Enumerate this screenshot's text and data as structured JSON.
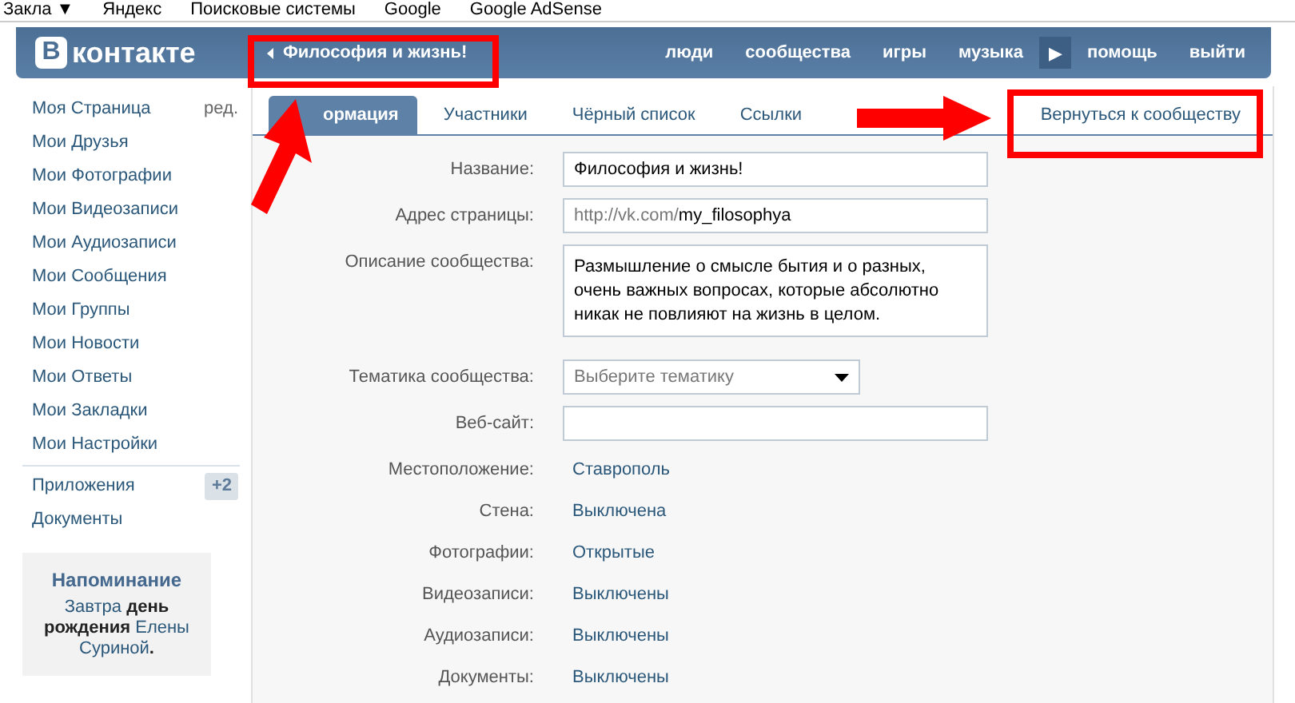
{
  "bookmarks": [
    {
      "label": "Закла",
      "dropdown": "▼"
    },
    {
      "label": "Яндекс"
    },
    {
      "label": "Поисковые системы"
    },
    {
      "label": "Google"
    },
    {
      "label": "Google AdSense"
    }
  ],
  "header": {
    "logo_letter": "В",
    "logo_text": "контакте",
    "back_link": "Философия и жизнь!",
    "nav": [
      {
        "label": "люди",
        "kind": "link"
      },
      {
        "label": "сообщества",
        "kind": "link"
      },
      {
        "label": "игры",
        "kind": "link"
      },
      {
        "label": "музыка",
        "kind": "link"
      },
      {
        "label": "▶",
        "kind": "arrow"
      },
      {
        "label": "помощь",
        "kind": "link"
      },
      {
        "label": "выйти",
        "kind": "link"
      }
    ]
  },
  "sidebar": {
    "items": [
      {
        "label": "Моя Страница",
        "extra": "ред."
      },
      {
        "label": "Мои Друзья"
      },
      {
        "label": "Мои Фотографии"
      },
      {
        "label": "Мои Видеозаписи"
      },
      {
        "label": "Мои Аудиозаписи"
      },
      {
        "label": "Мои Сообщения"
      },
      {
        "label": "Мои Группы"
      },
      {
        "label": "Мои Новости"
      },
      {
        "label": "Мои Ответы"
      },
      {
        "label": "Мои Закладки"
      },
      {
        "label": "Мои Настройки"
      }
    ],
    "apps": [
      {
        "label": "Приложения",
        "badge": "+2"
      },
      {
        "label": "Документы"
      }
    ],
    "reminder": {
      "title": "Напоминание",
      "text": "Завтра **день рождения** Елены Суриной**.**"
    }
  },
  "tabs": [
    {
      "label": "ормация",
      "selected": true
    },
    {
      "label": "Участники",
      "selected": false
    },
    {
      "label": "Чёрный список",
      "selected": false
    },
    {
      "label": "Ссылки",
      "selected": false
    }
  ],
  "back_to_community": "Вернуться к сообществу",
  "form": [
    {
      "kind": "input",
      "label": "Название:",
      "value": "Философия и жизнь!"
    },
    {
      "kind": "address",
      "label": "Адрес страницы:",
      "prefix": "http://vk.com/",
      "value": "my_filosophya"
    },
    {
      "kind": "textarea",
      "label": "Описание сообщества:",
      "value": "Размышление о смысле бытия и о разных, очень важных вопросах, которые абсолютно никак не повлияют на жизнь в целом."
    },
    {
      "kind": "select",
      "label": "Тематика сообщества:",
      "placeholder": "Выберите тематику"
    },
    {
      "kind": "input",
      "label": "Веб-сайт:"
    },
    {
      "kind": "static",
      "label": "Местоположение:",
      "value": "Ставрополь"
    },
    {
      "kind": "static",
      "label": "Стена:",
      "value": "Выключена"
    },
    {
      "kind": "static",
      "label": "Фотографии:",
      "value": "Открытые"
    },
    {
      "kind": "static",
      "label": "Видеозаписи:",
      "value": "Выключены"
    },
    {
      "kind": "static",
      "label": "Аудиозаписи:",
      "value": "Выключены"
    },
    {
      "kind": "static",
      "label": "Документы:",
      "value": "Выключены"
    }
  ]
}
